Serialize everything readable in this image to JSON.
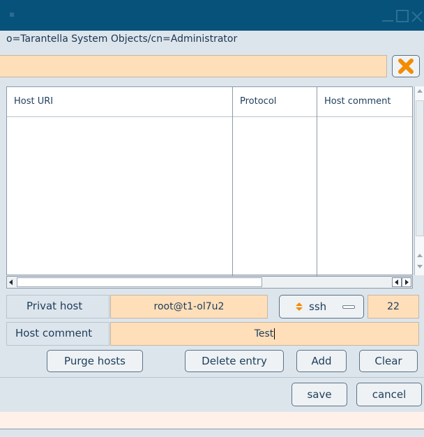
{
  "window": {
    "dn": "o=Tarantella System Objects/cn=Administrator"
  },
  "filter": {
    "value": "",
    "clear_icon": "x-icon",
    "accent": "#f28c00"
  },
  "table": {
    "columns": [
      "Host URI",
      "Protocol",
      "Host comment"
    ],
    "rows": []
  },
  "form": {
    "privat_host_label": "Privat host",
    "privat_host_value": "root@t1-ol7u2",
    "protocol_value": "ssh",
    "port_value": "22",
    "host_comment_label": "Host comment",
    "host_comment_value": "Test"
  },
  "buttons": {
    "purge": "Purge hosts",
    "delete": "Delete entry",
    "add": "Add",
    "clear": "Clear",
    "save": "save",
    "cancel": "cancel"
  },
  "colors": {
    "titlebar": "#06527a",
    "field_bg": "#fedfba",
    "panel_bg": "#dde5ec"
  }
}
